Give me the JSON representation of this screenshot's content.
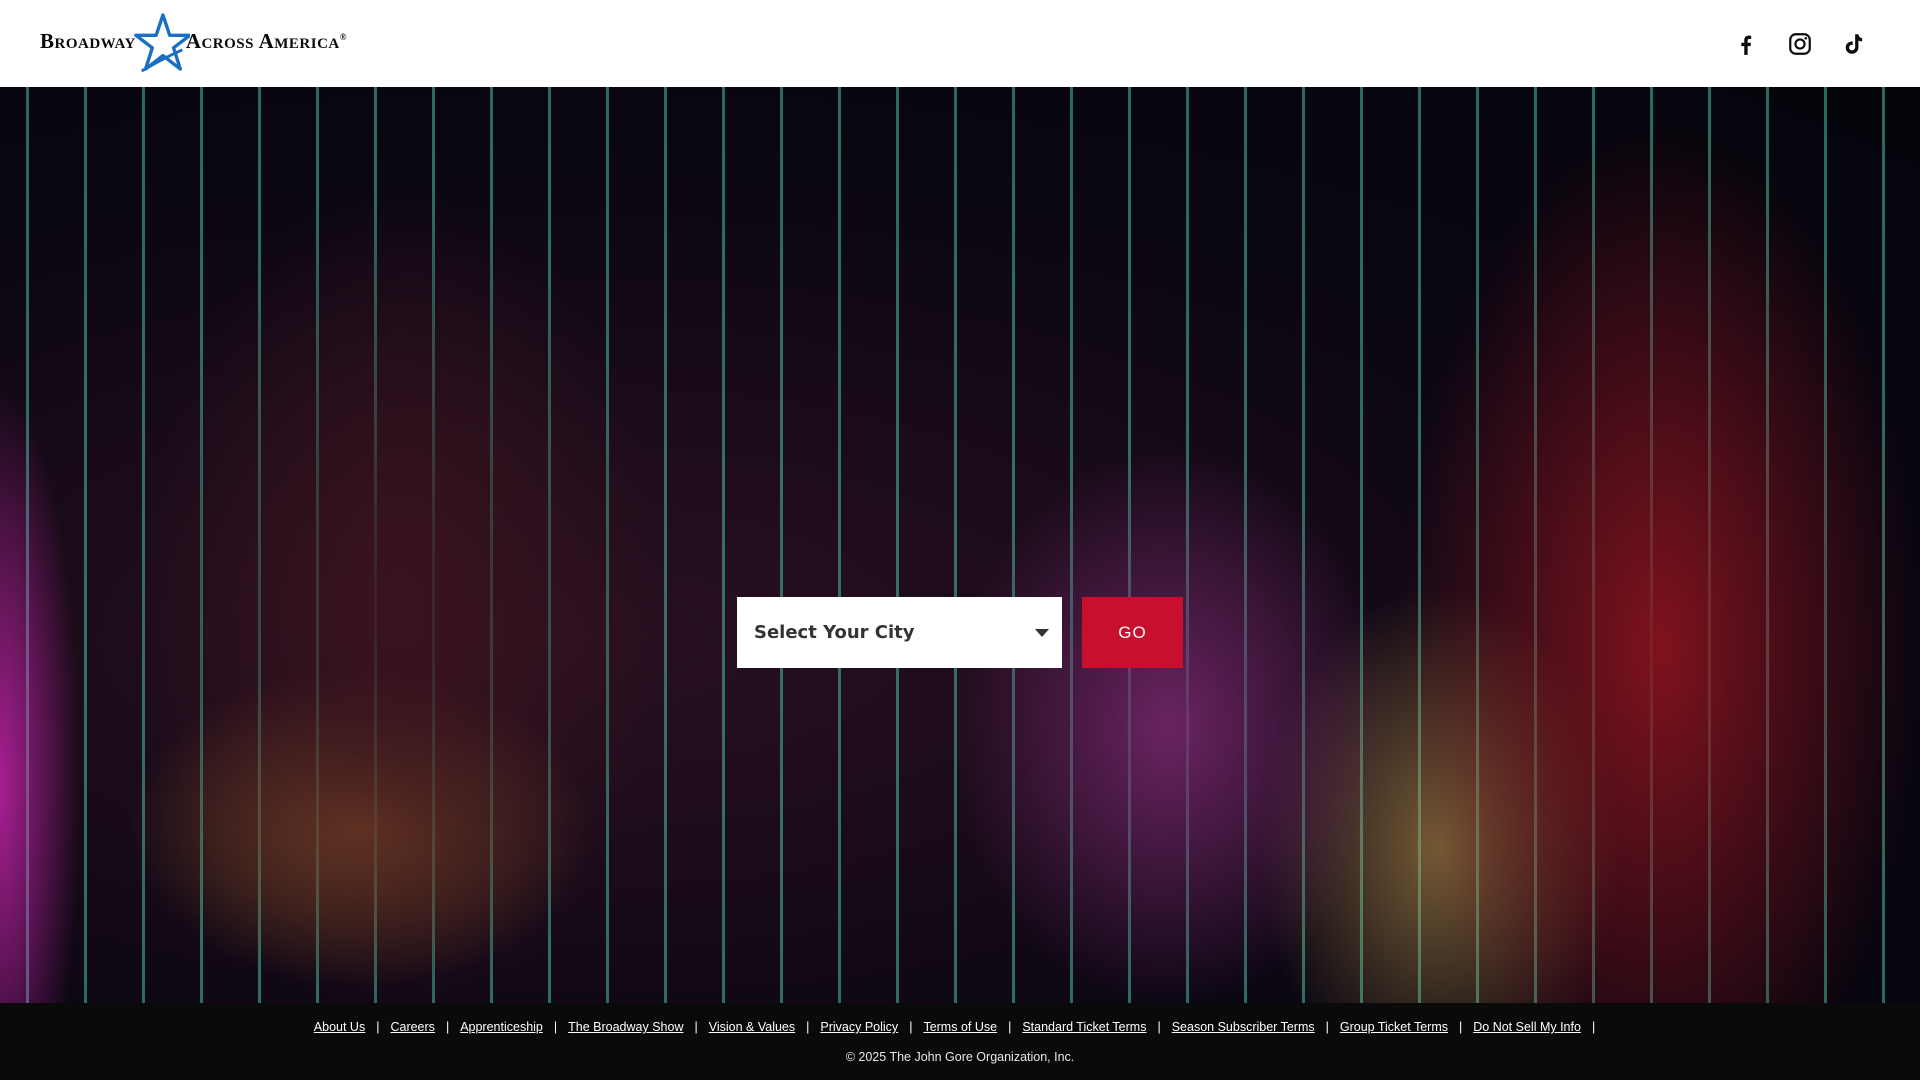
{
  "header": {
    "logo": {
      "word1": "Broadway",
      "word2": "Across America",
      "reg": "®",
      "star_color": "#1a6fc4"
    },
    "social": [
      {
        "icon": "facebook-icon"
      },
      {
        "icon": "instagram-icon"
      },
      {
        "icon": "tiktok-icon"
      }
    ]
  },
  "hero": {
    "city_select": {
      "label": "Select Your City"
    },
    "go_button": {
      "label": "GO",
      "color": "#c8102e"
    }
  },
  "footer": {
    "links": [
      "About Us",
      "Careers",
      "Apprenticeship",
      "The Broadway Show",
      "Vision & Values",
      "Privacy Policy",
      "Terms of Use",
      "Standard Ticket Terms",
      "Season Subscriber Terms ",
      "Group Ticket Terms",
      "Do Not Sell My Info"
    ],
    "separator": "|",
    "copyright": "© 2025 The John Gore Organization, Inc."
  }
}
